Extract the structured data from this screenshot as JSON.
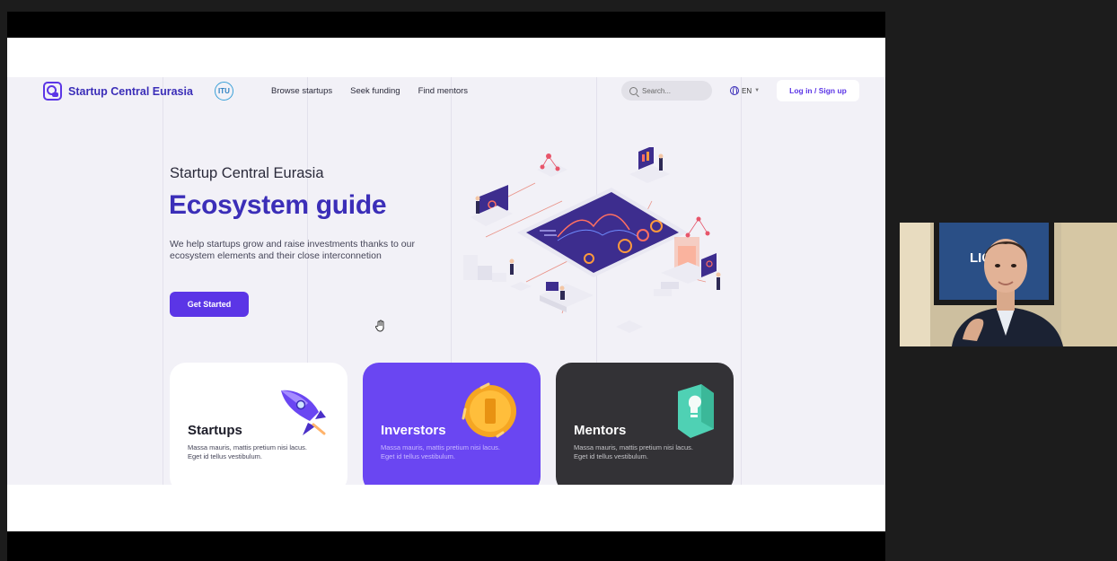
{
  "site": {
    "brand": "Startup Central Eurasia",
    "partner_logo": "ITU",
    "nav": {
      "links": [
        "Browse startups",
        "Seek funding",
        "Find mentors"
      ],
      "search_placeholder": "Search...",
      "language": "EN",
      "login_label": "Log in / Sign up"
    },
    "hero": {
      "eyebrow": "Startup Central Eurasia",
      "headline": "Ecosystem guide",
      "tagline": "We help startups grow and raise investments thanks to our ecosystem elements and their close interconnetion",
      "cta_label": "Get Started"
    },
    "cards": [
      {
        "title": "Startups",
        "text": "Massa mauris, mattis pretium nisi lacus. Eget id tellus vestibulum.",
        "icon": "rocket-icon"
      },
      {
        "title": "Inverstors",
        "text": "Massa mauris, mattis pretium nisi lacus. Eget id tellus vestibulum.",
        "icon": "coin-icon"
      },
      {
        "title": "Mentors",
        "text": "Massa mauris, mattis pretium nisi lacus. Eget id tellus vestibulum.",
        "icon": "lightbulb-icon"
      }
    ]
  },
  "webcam": {
    "poster_text": "LIGHT FI"
  },
  "colors": {
    "brand": "#5b35e6",
    "brand_dark": "#3b2eb8",
    "investors_card": "#6a46f2",
    "mentors_card": "#333236",
    "page_bg": "#f2f1f7"
  }
}
